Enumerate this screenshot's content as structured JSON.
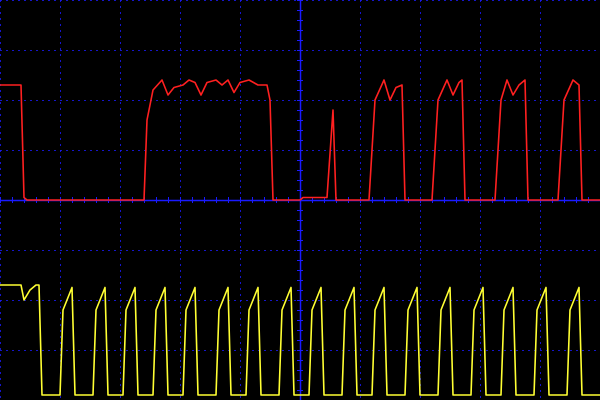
{
  "chart_data": {
    "type": "line",
    "title": "",
    "xlabel": "",
    "ylabel": "",
    "grid": true,
    "grid_divisions": {
      "x": 10,
      "y": 8
    },
    "xlim": [
      0,
      10
    ],
    "ylim": [
      -4,
      4
    ],
    "colors": {
      "background": "#000000",
      "grid": "#1a1aff",
      "red_trace": "#ff2020",
      "yellow_trace": "#ffff33"
    },
    "series": [
      {
        "color": "#ff2020",
        "points": [
          [
            0.0,
            2.3
          ],
          [
            0.35,
            2.3
          ],
          [
            0.4,
            0.05
          ],
          [
            0.45,
            0.0
          ],
          [
            2.4,
            0.0
          ],
          [
            2.45,
            1.6
          ],
          [
            2.55,
            2.2
          ],
          [
            2.7,
            2.4
          ],
          [
            2.8,
            2.1
          ],
          [
            2.9,
            2.25
          ],
          [
            3.05,
            2.3
          ],
          [
            3.15,
            2.4
          ],
          [
            3.25,
            2.35
          ],
          [
            3.35,
            2.1
          ],
          [
            3.45,
            2.35
          ],
          [
            3.6,
            2.4
          ],
          [
            3.7,
            2.3
          ],
          [
            3.8,
            2.4
          ],
          [
            3.9,
            2.15
          ],
          [
            4.0,
            2.35
          ],
          [
            4.15,
            2.4
          ],
          [
            4.3,
            2.3
          ],
          [
            4.45,
            2.3
          ],
          [
            4.5,
            2.0
          ],
          [
            4.55,
            0.0
          ],
          [
            5.0,
            0.0
          ],
          [
            5.05,
            0.05
          ],
          [
            5.4,
            0.05
          ],
          [
            5.45,
            0.05
          ],
          [
            5.55,
            1.8
          ],
          [
            5.6,
            0.0
          ],
          [
            6.15,
            0.0
          ],
          [
            6.25,
            2.0
          ],
          [
            6.4,
            2.4
          ],
          [
            6.5,
            2.0
          ],
          [
            6.6,
            2.25
          ],
          [
            6.7,
            2.3
          ],
          [
            6.75,
            0.0
          ],
          [
            7.2,
            0.0
          ],
          [
            7.3,
            2.0
          ],
          [
            7.45,
            2.4
          ],
          [
            7.55,
            2.1
          ],
          [
            7.65,
            2.35
          ],
          [
            7.7,
            2.4
          ],
          [
            7.75,
            0.0
          ],
          [
            8.25,
            0.0
          ],
          [
            8.35,
            2.0
          ],
          [
            8.45,
            2.4
          ],
          [
            8.55,
            2.1
          ],
          [
            8.65,
            2.3
          ],
          [
            8.75,
            2.4
          ],
          [
            8.8,
            0.0
          ],
          [
            9.3,
            0.0
          ],
          [
            9.4,
            2.0
          ],
          [
            9.55,
            2.4
          ],
          [
            9.65,
            2.3
          ],
          [
            9.7,
            0.0
          ],
          [
            10.0,
            0.0
          ]
        ]
      },
      {
        "color": "#ffff33",
        "points": [
          [
            0.0,
            -1.7
          ],
          [
            0.35,
            -1.7
          ],
          [
            0.4,
            -2.0
          ],
          [
            0.5,
            -1.8
          ],
          [
            0.6,
            -1.7
          ],
          [
            0.65,
            -1.7
          ],
          [
            0.7,
            -3.9
          ],
          [
            1.0,
            -3.9
          ],
          [
            1.05,
            -2.2
          ],
          [
            1.15,
            -1.9
          ],
          [
            1.2,
            -1.75
          ],
          [
            1.25,
            -3.9
          ],
          [
            1.55,
            -3.9
          ],
          [
            1.6,
            -2.2
          ],
          [
            1.7,
            -1.9
          ],
          [
            1.75,
            -1.75
          ],
          [
            1.8,
            -3.9
          ],
          [
            2.05,
            -3.9
          ],
          [
            2.1,
            -2.2
          ],
          [
            2.2,
            -1.9
          ],
          [
            2.25,
            -1.75
          ],
          [
            2.3,
            -3.9
          ],
          [
            2.55,
            -3.9
          ],
          [
            2.6,
            -2.2
          ],
          [
            2.7,
            -1.9
          ],
          [
            2.75,
            -1.75
          ],
          [
            2.8,
            -3.9
          ],
          [
            3.05,
            -3.9
          ],
          [
            3.1,
            -2.2
          ],
          [
            3.2,
            -1.9
          ],
          [
            3.25,
            -1.75
          ],
          [
            3.3,
            -3.9
          ],
          [
            3.6,
            -3.9
          ],
          [
            3.65,
            -2.2
          ],
          [
            3.75,
            -1.9
          ],
          [
            3.8,
            -1.75
          ],
          [
            3.85,
            -3.9
          ],
          [
            4.1,
            -3.9
          ],
          [
            4.15,
            -2.2
          ],
          [
            4.25,
            -1.9
          ],
          [
            4.3,
            -1.75
          ],
          [
            4.35,
            -3.9
          ],
          [
            4.65,
            -3.9
          ],
          [
            4.7,
            -2.2
          ],
          [
            4.8,
            -1.9
          ],
          [
            4.85,
            -1.75
          ],
          [
            4.9,
            -3.9
          ],
          [
            5.15,
            -3.9
          ],
          [
            5.2,
            -2.2
          ],
          [
            5.3,
            -1.9
          ],
          [
            5.35,
            -1.75
          ],
          [
            5.4,
            -3.9
          ],
          [
            5.7,
            -3.9
          ],
          [
            5.75,
            -2.2
          ],
          [
            5.85,
            -1.9
          ],
          [
            5.9,
            -1.75
          ],
          [
            5.95,
            -3.9
          ],
          [
            6.2,
            -3.9
          ],
          [
            6.25,
            -2.2
          ],
          [
            6.35,
            -1.9
          ],
          [
            6.4,
            -1.75
          ],
          [
            6.45,
            -3.9
          ],
          [
            6.75,
            -3.9
          ],
          [
            6.8,
            -2.2
          ],
          [
            6.9,
            -1.9
          ],
          [
            6.95,
            -1.75
          ],
          [
            7.0,
            -3.9
          ],
          [
            7.3,
            -3.9
          ],
          [
            7.35,
            -2.2
          ],
          [
            7.45,
            -1.9
          ],
          [
            7.5,
            -1.75
          ],
          [
            7.55,
            -3.9
          ],
          [
            7.85,
            -3.9
          ],
          [
            7.9,
            -2.2
          ],
          [
            8.0,
            -1.9
          ],
          [
            8.05,
            -1.75
          ],
          [
            8.1,
            -3.9
          ],
          [
            8.35,
            -3.9
          ],
          [
            8.4,
            -2.2
          ],
          [
            8.5,
            -1.9
          ],
          [
            8.55,
            -1.75
          ],
          [
            8.6,
            -3.9
          ],
          [
            8.9,
            -3.9
          ],
          [
            8.95,
            -2.2
          ],
          [
            9.05,
            -1.9
          ],
          [
            9.1,
            -1.75
          ],
          [
            9.15,
            -3.9
          ],
          [
            9.45,
            -3.9
          ],
          [
            9.5,
            -2.2
          ],
          [
            9.6,
            -1.9
          ],
          [
            9.65,
            -1.75
          ],
          [
            9.7,
            -3.9
          ],
          [
            10.0,
            -3.9
          ]
        ]
      }
    ]
  }
}
